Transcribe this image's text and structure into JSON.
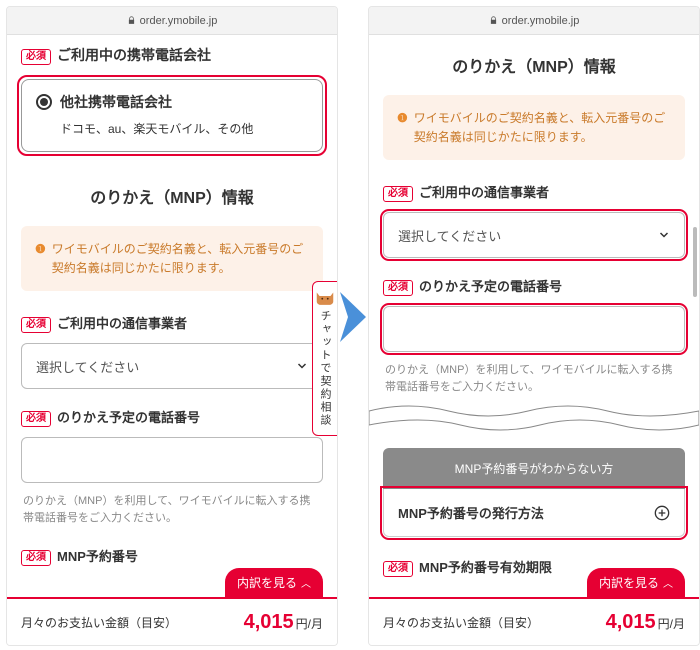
{
  "url": "order.ymobile.jp",
  "required_label": "必須",
  "left": {
    "carrier_section": "ご利用中の携帯電話会社",
    "radio_title": "他社携帯電話会社",
    "radio_sub": "ドコモ、au、楽天モバイル、その他",
    "mnp_title": "のりかえ（MNP）情報",
    "notice": "ワイモバイルのご契約名義と、転入元番号のご契約名義は同じかたに限ります。",
    "carrier_field": "ご利用中の通信事業者",
    "select_placeholder": "選択してください",
    "phone_field": "のりかえ予定の電話番号",
    "phone_help": "のりかえ（MNP）を利用して、ワイモバイルに転入する携帯電話番号をご入力ください。",
    "mnp_num_field": "MNP予約番号",
    "chat_label": "チャットで契約相談"
  },
  "right": {
    "mnp_title": "のりかえ（MNP）情報",
    "notice": "ワイモバイルのご契約名義と、転入元番号のご契約名義は同じかたに限ります。",
    "carrier_field": "ご利用中の通信事業者",
    "select_placeholder": "選択してください",
    "phone_field": "のりかえ予定の電話番号",
    "phone_help": "のりかえ（MNP）を利用して、ワイモバイルに転入する携帯電話番号をご入力ください。",
    "gap_banner": "MNP予約番号がわからない方",
    "expander": "MNP予約番号の発行方法",
    "expiry_field": "MNP予約番号有効期限"
  },
  "footer": {
    "label": "月々のお支払い金額（目安）",
    "price": "4,015",
    "unit": "円/月",
    "details": "内訳を見る"
  }
}
